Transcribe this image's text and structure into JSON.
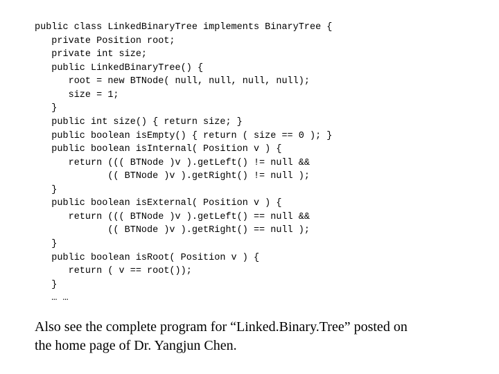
{
  "code": {
    "l01": "public class LinkedBinaryTree implements BinaryTree {",
    "l02": "   private Position root;",
    "l03": "   private int size;",
    "l04": "   public LinkedBinaryTree() {",
    "l05": "      root = new BTNode( null, null, null, null);",
    "l06": "      size = 1;",
    "l07": "   }",
    "l08": "   public int size() { return size; }",
    "l09": "   public boolean isEmpty() { return ( size == 0 ); }",
    "l10": "   public boolean isInternal( Position v ) {",
    "l11": "      return ((( BTNode )v ).getLeft() != null &&",
    "l12": "             (( BTNode )v ).getRight() != null );",
    "l13": "   }",
    "l14": "   public boolean isExternal( Position v ) {",
    "l15": "      return ((( BTNode )v ).getLeft() == null &&",
    "l16": "             (( BTNode )v ).getRight() == null );",
    "l17": "   }",
    "l18": "   public boolean isRoot( Position v ) {",
    "l19": "      return ( v == root());",
    "l20": "   }",
    "l21": "   … …"
  },
  "caption": {
    "line1": "Also see the complete program for “Linked.Binary.Tree” posted on",
    "line2": "the home page of Dr. Yangjun Chen."
  }
}
